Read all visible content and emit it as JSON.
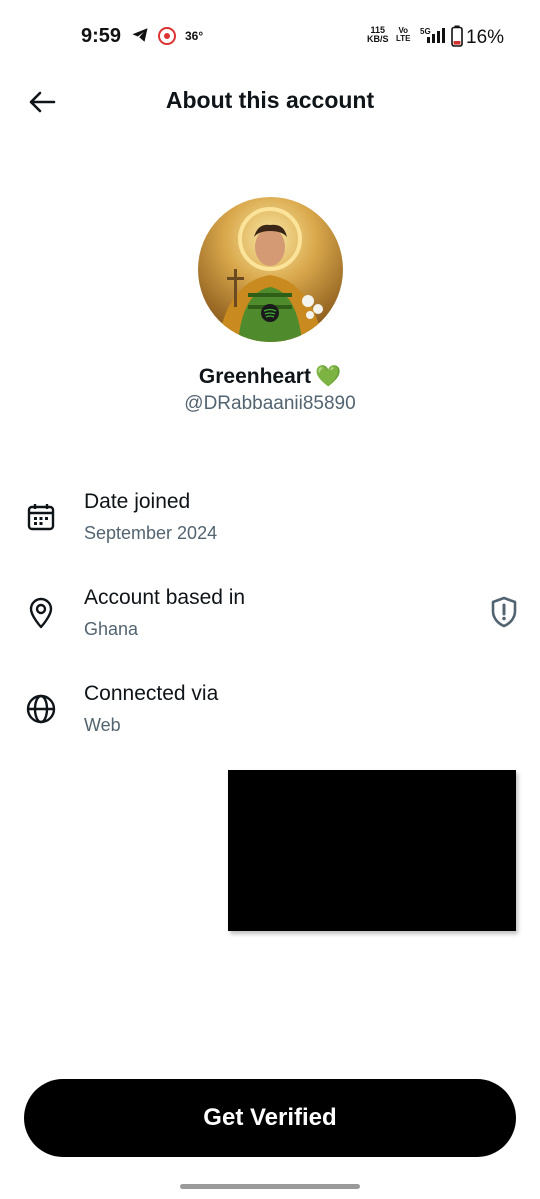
{
  "status_bar": {
    "time": "9:59",
    "temperature": "36°",
    "net_speed_value": "115",
    "net_speed_unit": "KB/S",
    "volte_top": "Vo",
    "volte_bottom": "LTE",
    "network": "5G",
    "battery": "16%",
    "icons": [
      "telegram-icon",
      "notification-app-icon",
      "signal-icon",
      "battery-icon"
    ]
  },
  "header": {
    "back_icon": "arrow-left-icon",
    "title": "About this account"
  },
  "profile": {
    "display_name": "Greenheart",
    "name_emoji": "💚",
    "handle": "@DRabbaanii85890"
  },
  "info_rows": [
    {
      "icon": "calendar-icon",
      "title": "Date joined",
      "value": "September 2024"
    },
    {
      "icon": "location-pin-icon",
      "title": "Account based in",
      "value": "Ghana",
      "trailing_icon": "shield-exclamation-icon"
    },
    {
      "icon": "globe-icon",
      "title": "Connected via",
      "value": "Web"
    }
  ],
  "cta": {
    "label": "Get Verified"
  },
  "colors": {
    "text_primary": "#0f1419",
    "text_secondary": "#536471",
    "button_bg": "#000000",
    "button_text": "#ffffff",
    "heart": "#3fae35"
  }
}
